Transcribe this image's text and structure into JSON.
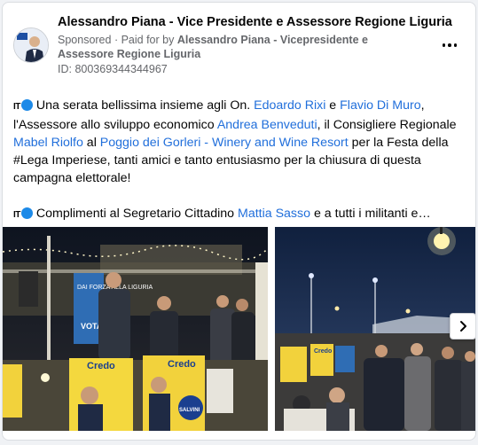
{
  "post": {
    "page_name": "Alessandro Piana - Vice Presidente e Assessore Regione Liguria",
    "sponsored_label": "Sponsored",
    "paid_for_prefix": "Paid for by",
    "paid_for_by": "Alessandro Piana - Vicepresidente e Assessore Regione Liguria",
    "ad_id": "ID: 800369344344967",
    "menu_icon": "more-horizontal-icon"
  },
  "body": {
    "flag": "IT",
    "p1": [
      {
        "t": "Una serata bellissima insieme agli On. "
      },
      {
        "t": "Edoardo Rixi",
        "link": true
      },
      {
        "t": " e "
      },
      {
        "t": "Flavio Di Muro",
        "link": true
      },
      {
        "t": ", l'Assessore allo sviluppo economico "
      },
      {
        "t": "Andrea Benveduti",
        "link": true
      },
      {
        "t": ", il Consigliere Regionale "
      },
      {
        "t": "Mabel Riolfo",
        "link": true
      },
      {
        "t": " al "
      },
      {
        "t": "Poggio dei Gorleri - Winery and Wine Resort",
        "link": true
      },
      {
        "t": " per la Festa della #Lega Imperiese, tanti amici e tanto entusiasmo per la chiusura di questa campagna elettorale!"
      }
    ],
    "p2": [
      {
        "t": "Complimenti al Segretario Cittadino "
      },
      {
        "t": "Mattia Sasso",
        "link": true
      },
      {
        "t": " e a tutti i militanti e…"
      }
    ]
  },
  "gallery": {
    "photo1": {
      "sign_text": "Credo",
      "name_text": "SALVINI",
      "banner_text": "DAI FORZA ALLA LIGURIA",
      "vote_text": "VOTA"
    },
    "photo2": {
      "sign_text": "Credo"
    },
    "next_icon": "chevron-right-icon"
  },
  "colors": {
    "link": "#216fdb",
    "muted": "#65676b",
    "dot": "#1d8ae8"
  }
}
